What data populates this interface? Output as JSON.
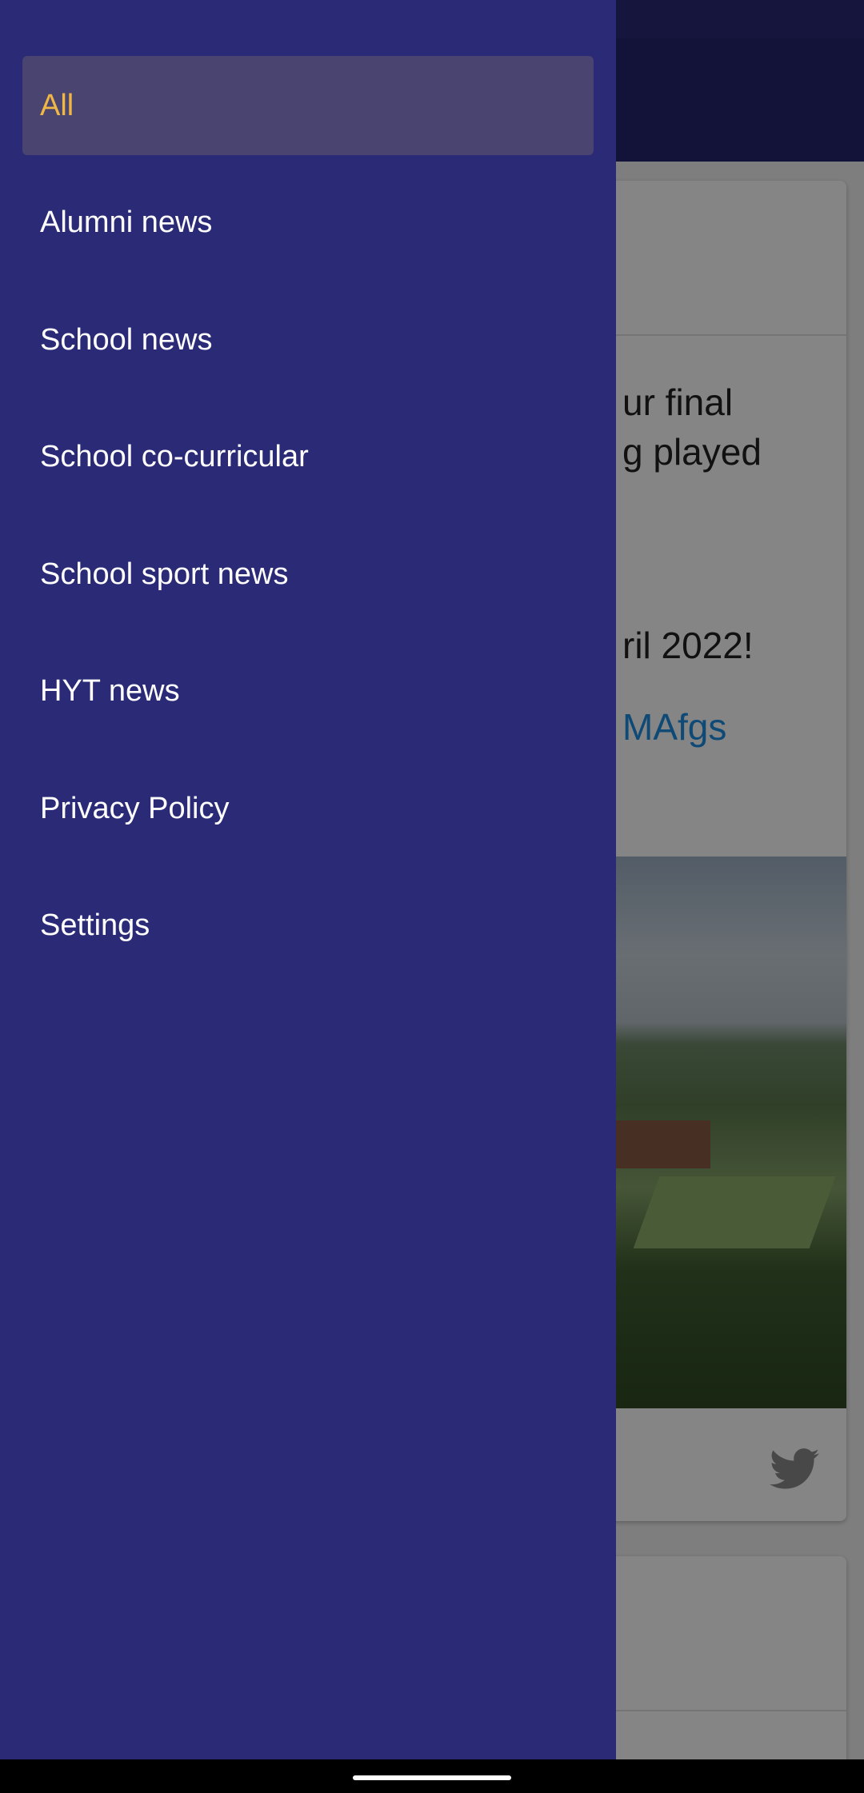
{
  "drawer": {
    "items": [
      {
        "label": "All",
        "active": true
      },
      {
        "label": "Alumni news",
        "active": false
      },
      {
        "label": "School news",
        "active": false
      },
      {
        "label": "School co-curricular",
        "active": false
      },
      {
        "label": "School sport news",
        "active": false
      },
      {
        "label": "HYT news",
        "active": false
      },
      {
        "label": "Privacy Policy",
        "active": false
      },
      {
        "label": "Settings",
        "active": false
      }
    ],
    "colors": {
      "background": "#2a2a77",
      "active_background": "#4a4470",
      "active_text": "#f0b744",
      "text": "#ffffff"
    }
  },
  "background_app": {
    "post": {
      "text_line_1": "ur final",
      "text_line_2": "g played",
      "text_line_3": "ril 2022!",
      "link": "MAfgs",
      "footer_icon": "twitter-icon"
    },
    "colors": {
      "app_bar": "#25236b",
      "link": "#1d8ce0"
    }
  }
}
